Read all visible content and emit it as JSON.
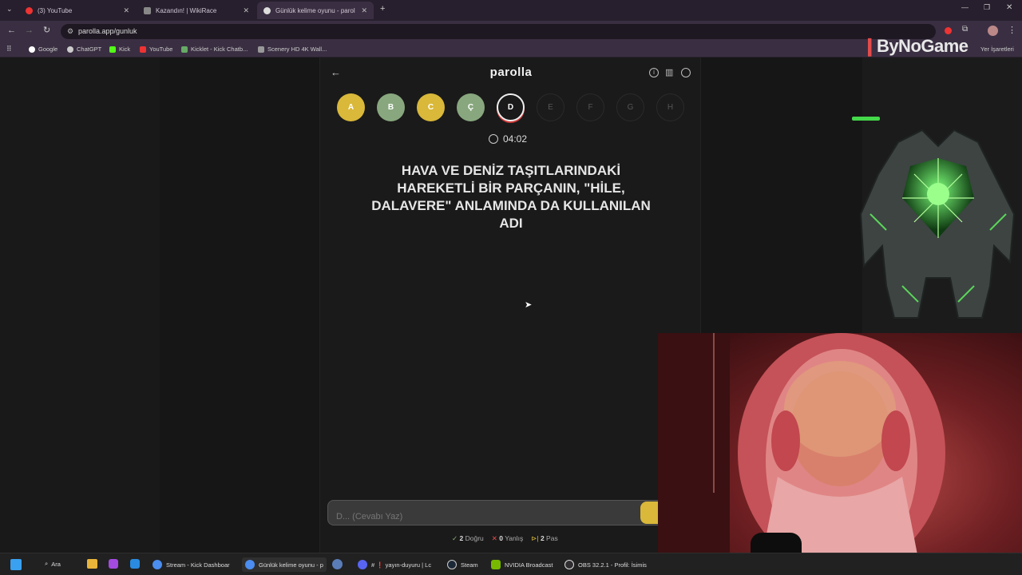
{
  "browser": {
    "tabs": [
      {
        "title": "(3) YouTube"
      },
      {
        "title": "Kazandın! | WikiRace"
      },
      {
        "title": "Günlük kelime oyunu - parolla"
      }
    ],
    "url": "parolla.app/gunluk",
    "bookmarks": [
      "Google",
      "ChatGPT",
      "Kick",
      "YouTube",
      "Kicklet - Kick Chatb...",
      "Scenery HD 4K Wall..."
    ],
    "bookmarks_right": "Yer İşaretleri"
  },
  "app": {
    "title": "parolla",
    "letters": [
      {
        "letter": "A",
        "state": "yellow"
      },
      {
        "letter": "B",
        "state": "green"
      },
      {
        "letter": "C",
        "state": "yellow"
      },
      {
        "letter": "Ç",
        "state": "green"
      },
      {
        "letter": "D",
        "state": "current"
      },
      {
        "letter": "E",
        "state": "empty"
      },
      {
        "letter": "F",
        "state": "empty"
      },
      {
        "letter": "G",
        "state": "empty"
      },
      {
        "letter": "H",
        "state": "empty"
      }
    ],
    "timer": "04:02",
    "question": "HAVA VE DENİZ TAŞITLARINDAKİ HAREKETLİ BİR PARÇANIN, \"HİLE, DALAVERE\" ANLAMINDA DA KULLANILAN ADI",
    "answer_placeholder": "D... (Cevabı Yaz)",
    "stats": {
      "correct_count": "2",
      "correct_label": "Doğru",
      "wrong_count": "0",
      "wrong_label": "Yanlış",
      "pass_count": "2",
      "pass_label": "Pas"
    }
  },
  "overlay": {
    "logo": "ByNoGame"
  },
  "taskbar": {
    "search": "Ara",
    "items": [
      "Stream - Kick Dashboar",
      "Günlük kelime oyunu - p",
      "# ❗ yayın-duyuru | Lc",
      "Steam",
      "NVIDIA Broadcast",
      "OBS 32.2.1 - Profil: İsimis"
    ]
  },
  "colors": {
    "yellow": "#d9b83a",
    "green": "#88a77e",
    "wrong": "#e24c4c",
    "accent": "#d9b83a"
  }
}
